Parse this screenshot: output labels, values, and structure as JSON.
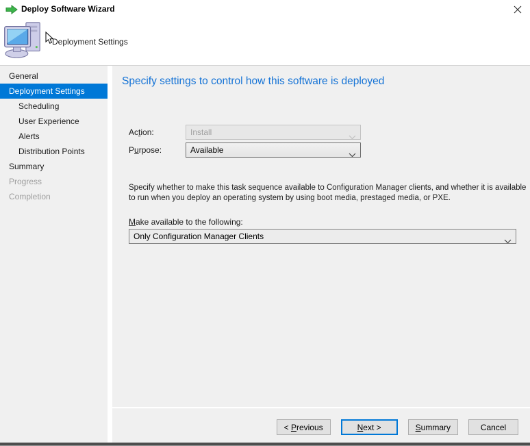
{
  "window": {
    "title": "Deploy Software Wizard"
  },
  "header": {
    "page_title": "Deployment Settings"
  },
  "sidebar": {
    "items": [
      {
        "label": "General",
        "state": "enabled",
        "indent": 0
      },
      {
        "label": "Deployment Settings",
        "state": "selected",
        "indent": 0
      },
      {
        "label": "Scheduling",
        "state": "enabled",
        "indent": 1
      },
      {
        "label": "User Experience",
        "state": "enabled",
        "indent": 1
      },
      {
        "label": "Alerts",
        "state": "enabled",
        "indent": 1
      },
      {
        "label": "Distribution Points",
        "state": "enabled",
        "indent": 1
      },
      {
        "label": "Summary",
        "state": "enabled",
        "indent": 0
      },
      {
        "label": "Progress",
        "state": "disabled",
        "indent": 0
      },
      {
        "label": "Completion",
        "state": "disabled",
        "indent": 0
      }
    ]
  },
  "content": {
    "heading": "Specify settings to control how this software is deployed",
    "fields": {
      "action": {
        "label_pre": "Ac",
        "label_accel": "t",
        "label_post": "ion:",
        "value": "Install",
        "enabled": false
      },
      "purpose": {
        "label_pre": "P",
        "label_accel": "u",
        "label_post": "rpose:",
        "value": "Available",
        "enabled": true
      }
    },
    "description": "Specify whether to make this task sequence available to Configuration Manager clients, and whether it is available to run when you deploy an operating system by using boot media, prestaged media, or PXE.",
    "make_available": {
      "label_pre": "",
      "label_accel": "M",
      "label_post": "ake available to the following:",
      "value": "Only Configuration Manager Clients"
    }
  },
  "footer": {
    "buttons": {
      "previous": {
        "pre": "< ",
        "accel": "P",
        "post": "revious"
      },
      "next": {
        "pre": "",
        "accel": "N",
        "post": "ext >"
      },
      "summary": {
        "pre": "",
        "accel": "S",
        "post": "ummary"
      },
      "cancel": {
        "pre": "",
        "accel": "",
        "post": "Cancel"
      }
    }
  },
  "colors": {
    "accent": "#0078d7",
    "heading_blue": "#1573d6",
    "selection_bg": "#0078d7",
    "disabled_text": "#9d9d9d",
    "bottom_bar": "#4d4d4d"
  }
}
